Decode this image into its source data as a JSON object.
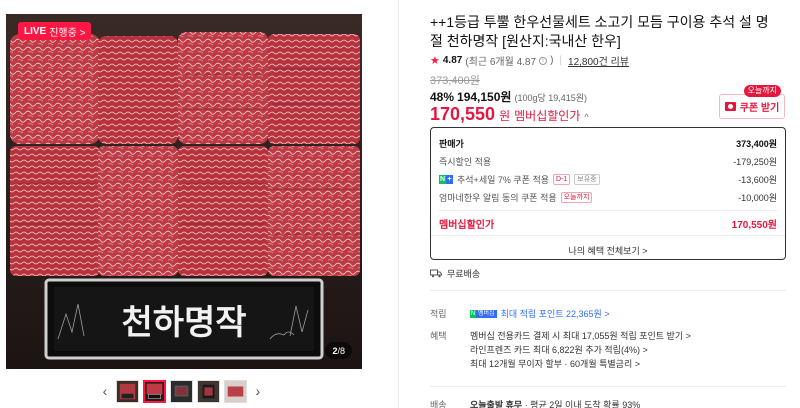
{
  "media": {
    "live_badge": "LIVE",
    "live_badge_sub": "진행중 >",
    "engraving": "천하명작",
    "page_current": "2",
    "page_total": "/8"
  },
  "thumbnails": {
    "prev_icon": "‹",
    "next_icon": "›"
  },
  "product": {
    "title": "++1등급 투뿔 한우선물세트 소고기 모듬 구이용 추석 설 명절 천하명작 [원산지:국내산 한우]",
    "rating": "4.87",
    "rating_detail": "(최근 6개월 4.87",
    "rating_detail_close": ")",
    "review_count": "12,800건 리뷰",
    "original_price": "373,400원",
    "discount_rate": "48%",
    "sale_price": "194,150원",
    "unit_price": "(100g당 19,415원)",
    "member_price": "170,550",
    "member_price_unit": "원",
    "member_label": "멤버십할인가",
    "member_caret": "^"
  },
  "coupon": {
    "today_tag": "오늘까지",
    "label": "쿠폰 받기"
  },
  "breakdown": {
    "rows": [
      {
        "label": "판매가",
        "value": "373,400원"
      },
      {
        "label": "즉시할인 적용",
        "value": "-179,250원"
      },
      {
        "label": "추석+세일 7% 쿠폰 적용",
        "tag": "D-1",
        "tag2": "보유중",
        "value": "-13,600원"
      },
      {
        "label": "엄마네한우 알림 동의 쿠폰 적용",
        "tag": "오늘까지",
        "value": "-10,000원"
      }
    ],
    "total_label": "멤버십할인가",
    "total_value": "170,550원",
    "more_label": "나의 혜택 전체보기 >"
  },
  "shipping": {
    "label": "무료배송"
  },
  "points": {
    "label": "적립",
    "badge_n": "N",
    "badge_m": "멤버십",
    "link": "최대 적립 포인트 22,365원 >"
  },
  "benefits": {
    "label": "혜택",
    "items": [
      "멤버십 전용카드 결제 시 최대 17,055원 적립 포인트 받기 >",
      "라인프렌즈 카드 최대 6,822원 추가 적립(4%) >",
      "최대 12개월 무이자 할부 · 60개월 특별금리 >"
    ]
  },
  "delivery": {
    "label": "배송",
    "text_bold": "오늘출발 휴무",
    "text": " · 평균 2일 이내 도착 확률 93%"
  },
  "colors": {
    "accent": "#e5173f",
    "live": "#ff1744",
    "link": "#2f6ef7",
    "naver_green": "#03c75a"
  }
}
